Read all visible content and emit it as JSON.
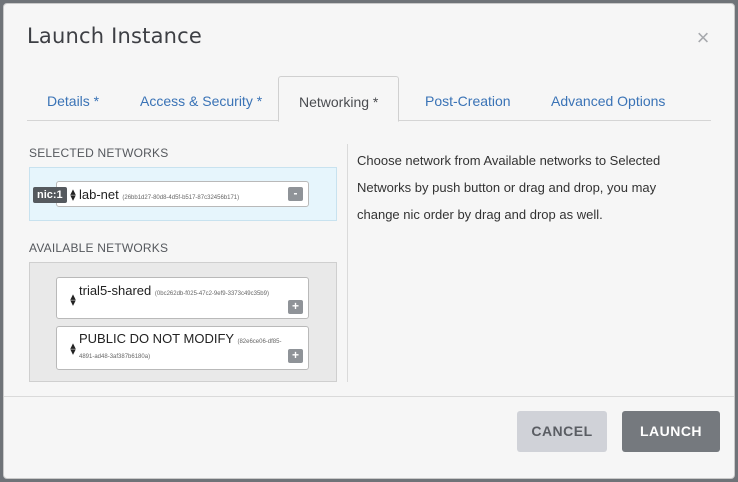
{
  "dialog": {
    "title": "Launch Instance",
    "close_glyph": "×"
  },
  "tabs": [
    {
      "label": "Details *"
    },
    {
      "label": "Access & Security *"
    },
    {
      "label": "Networking *",
      "active": true
    },
    {
      "label": "Post-Creation"
    },
    {
      "label": "Advanced Options"
    }
  ],
  "selected": {
    "heading": "SELECTED NETWORKS",
    "items": [
      {
        "nic": "nic:1",
        "name": "lab-net",
        "id": "(26bb1d27-80d8-4d5f-b517-87c32456b171)",
        "action": "-"
      }
    ]
  },
  "available": {
    "heading": "AVAILABLE NETWORKS",
    "items": [
      {
        "name": "trial5-shared",
        "id": "(0bc262db-f025-47c2-9ef9-3373c49c35b9)",
        "action": "+"
      },
      {
        "name": "PUBLIC DO NOT MODIFY",
        "id_line1": "(82e6ce06-df85-",
        "id_line2": "4891-ad48-3af387b6180a)",
        "action": "+"
      }
    ]
  },
  "help": {
    "text": "Choose network from Available networks to Selected Networks by push button or drag and drop, you may change nic order by drag and drop as well."
  },
  "footer": {
    "cancel_label": "CANCEL",
    "launch_label": "LAUNCH"
  },
  "icons": {
    "sort": "sort-arrows-icon",
    "close": "close-icon"
  },
  "colors": {
    "link": "#3a73b6",
    "selected_bg": "#e6f5fc",
    "launch_bg": "#75797e",
    "cancel_bg": "#d0d2d8"
  }
}
